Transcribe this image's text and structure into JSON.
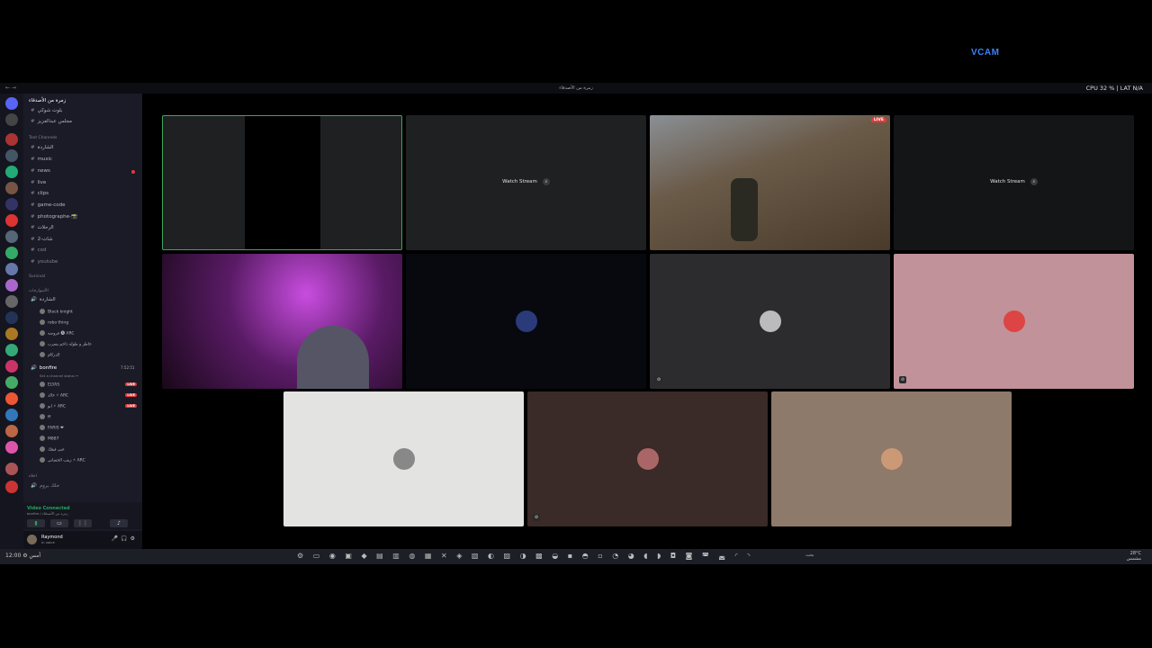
{
  "overlay": {
    "vcam": "VCAM"
  },
  "titlebar": {
    "title": "زمرة من الأصدقاء",
    "perf": "CPU 32 % | LAT N/A",
    "left_text": "← →"
  },
  "server": {
    "name": "زمرة من الأصدقاء"
  },
  "channels": {
    "pinned": [
      {
        "label": "بلوت شوكي"
      },
      {
        "label": "مجلس عبدالعزيز"
      }
    ],
    "text_category": "Text Channels",
    "text": [
      {
        "label": "الشاردة"
      },
      {
        "label": "music"
      },
      {
        "label": "news"
      },
      {
        "label": "live"
      },
      {
        "label": "clips"
      },
      {
        "label": "game-code"
      },
      {
        "label": "photographe-📸"
      },
      {
        "label": "الرحلات"
      },
      {
        "label": "شات-2"
      },
      {
        "label": "cod"
      },
      {
        "label": "youtube"
      }
    ],
    "voice_category": "Survival",
    "voice_sub": "الأسوارجات",
    "voice_channel1": "الشاردة",
    "voice1_users": [
      {
        "name": "Black knight"
      },
      {
        "name": "robo thing"
      },
      {
        "name": "فروضه 🅢 ARC"
      },
      {
        "name": "حاطر و طوله داجم يسرب"
      },
      {
        "name": "الدركام"
      }
    ],
    "bonfire": {
      "name": "bonfire",
      "time": "7:52:51",
      "status": "Set a channel status ✏"
    },
    "bonfire_users": [
      {
        "name": "ELYAS",
        "live": true
      },
      {
        "name": "خالد ⚡ ARC",
        "live": true
      },
      {
        "name": "ابو ⚡ ARC",
        "live": true
      },
      {
        "name": "ff",
        "live": false
      },
      {
        "name": "FARIS ❤",
        "live": false
      },
      {
        "name": "M887",
        "live": false
      },
      {
        "name": "عبي فيفك",
        "live": false
      },
      {
        "name": "زيتب الحساني ⚡ ARC",
        "live": false
      }
    ],
    "other_category": "اخلاء",
    "other_channel": "خلك بروم",
    "live_label": "LIVE"
  },
  "voice": {
    "status": "Video Connected",
    "sub": "bonfire / زمرة من الأصدقاء"
  },
  "user": {
    "name": "Raymond",
    "status": "In voice"
  },
  "stage": {
    "watch_stream": "Watch Stream",
    "live_label": "LIVE",
    "tile_colors": [
      "#1f2022",
      "#1f2022",
      "#6b5a46",
      "#141516",
      "#4a1a4e",
      "#08090f",
      "#2c2c2e",
      "#c1929a",
      "#e3e3e2",
      "#3a2a28",
      "#8e7a6a"
    ]
  },
  "taskbar": {
    "left": "أمس ⚙ 12:00",
    "right_top": "28°C",
    "right_bottom": "مشمس",
    "search": "بحث"
  }
}
